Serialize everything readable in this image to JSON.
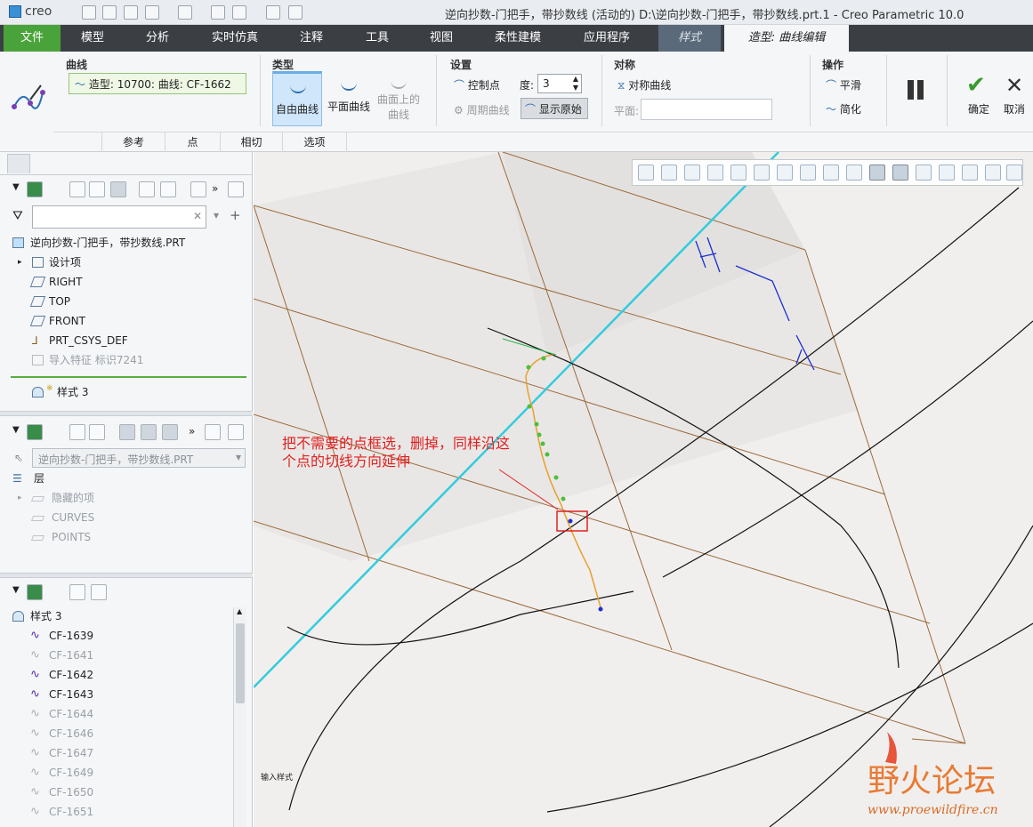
{
  "titlebar": {
    "logo": "creo",
    "title": "逆向抄数-门把手，带抄数线 (活动的) D:\\逆向抄数-门把手，带抄数线.prt.1 - Creo Parametric 10.0"
  },
  "menu": {
    "tabs": [
      "文件",
      "模型",
      "分析",
      "实时仿真",
      "注释",
      "工具",
      "视图",
      "柔性建模",
      "应用程序",
      "样式",
      "造型: 曲线编辑"
    ]
  },
  "ribbon": {
    "curve_group": "曲线",
    "curve_value": "造型: 10700: 曲线: CF-1662",
    "type_group": "类型",
    "type_free": "自由曲线",
    "type_planar": "平面曲线",
    "type_cos_1": "曲面上的",
    "type_cos_2": "曲线",
    "settings_group": "设置",
    "control_points": "控制点",
    "degree_label": "度:",
    "degree_value": "3",
    "periodic": "周期曲线",
    "show_original": "显示原始",
    "symmetry_group": "对称",
    "sym_curve": "对称曲线",
    "plane_label": "平面:",
    "ops_group": "操作",
    "smooth": "平滑",
    "simplify": "简化",
    "ok": "确定",
    "cancel": "取消",
    "subtabs": [
      "参考",
      "点",
      "相切",
      "选项"
    ]
  },
  "model_tree": {
    "root": "逆向抄数-门把手，带抄数线.PRT",
    "items": [
      "设计项",
      "RIGHT",
      "TOP",
      "FRONT",
      "PRT_CSYS_DEF",
      "导入特征 标识7241"
    ],
    "style_item": "样式 3"
  },
  "layers": {
    "combo": "逆向抄数-门把手，带抄数线.PRT",
    "root": "层",
    "items": [
      "隐藏的项",
      "CURVES",
      "POINTS"
    ]
  },
  "style_tree": {
    "root": "样式 3",
    "items": [
      {
        "name": "CF-1639",
        "dim": false
      },
      {
        "name": "CF-1641",
        "dim": true
      },
      {
        "name": "CF-1642",
        "dim": false
      },
      {
        "name": "CF-1643",
        "dim": false
      },
      {
        "name": "CF-1644",
        "dim": true
      },
      {
        "name": "CF-1646",
        "dim": true
      },
      {
        "name": "CF-1647",
        "dim": true
      },
      {
        "name": "CF-1649",
        "dim": true
      },
      {
        "name": "CF-1650",
        "dim": true
      },
      {
        "name": "CF-1651",
        "dim": true
      }
    ]
  },
  "viewport": {
    "annotation": "把不需要的点框选，删掉，同样沿这个点的切线方向延伸",
    "small_label": "输入样式",
    "watermark": "野火论坛",
    "watermark_url": "www.proewildfire.cn"
  }
}
